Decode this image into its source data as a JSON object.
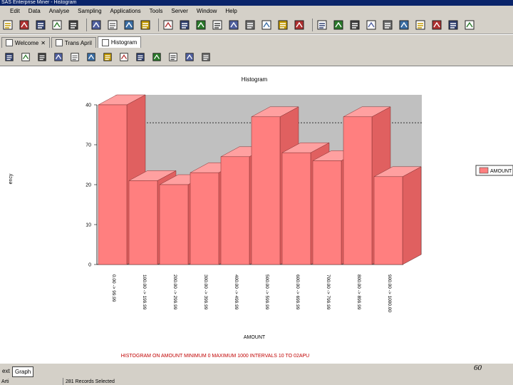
{
  "window": {
    "title": "SAS Enterprise Miner - Histogram"
  },
  "menu": [
    "Edit",
    "Data",
    "Analyse",
    "Sampling",
    "Applications",
    "Tools",
    "Server",
    "Window",
    "Help"
  ],
  "toolbar_icons": [
    "open-folder-icon",
    "open-icon",
    "save-icon",
    "export-icon",
    "print-icon",
    "undo-icon",
    "data-icon",
    "arrow-icon",
    "notes-icon",
    "document-icon",
    "table-icon",
    "edit-table-icon",
    "grid-icon",
    "grid-delete-icon",
    "sas-icon",
    "columns-icon",
    "refresh-icon",
    "percent-icon",
    "split-icon",
    "compare-icon",
    "sort-icon",
    "number-icon",
    "rank-icon",
    "stats-icon",
    "chart-icon",
    "globe-icon",
    "export-data-icon",
    "import-data-icon"
  ],
  "tabs": [
    {
      "label": "Welcome",
      "active": false
    },
    {
      "label": "Trans April",
      "active": false
    },
    {
      "label": "Histogram",
      "active": true
    }
  ],
  "graph_toolbar_icons": [
    "histogram-icon",
    "bar-chart-icon",
    "stacked-bar-icon",
    "line-chart-icon",
    "frame-icon",
    "picture-icon",
    "scatter-icon",
    "box-plot-icon",
    "image-icon",
    "calendar-icon",
    "camera-icon",
    "eye-icon",
    "rotate-icon"
  ],
  "chart_data": {
    "type": "bar",
    "title": "Histogram",
    "xlabel": "AMOUNT",
    "ylabel": "ency",
    "categories": [
      "0.00 -> 99.99",
      "100.00 -> 199.99",
      "200.00 -> 299.99",
      "300.00 -> 399.99",
      "400.00 -> 499.99",
      "500.00 -> 599.99",
      "600.00 -> 699.99",
      "700.00 -> 799.99",
      "800.00 -> 899.99",
      "900.00 -> 1000.00"
    ],
    "values": [
      40,
      21,
      20,
      23,
      27,
      37,
      28,
      26,
      37,
      22
    ],
    "ylim": [
      0,
      40
    ],
    "yticks": [
      0,
      10,
      20,
      30,
      40
    ],
    "ytick_labels": [
      "0",
      "10",
      "20",
      "70",
      "40"
    ],
    "reference_line": 33,
    "bar_color": "#ff7f7f",
    "wall_color": "#c0c0c0",
    "legend": {
      "label": "AMOUNT",
      "position": "right"
    },
    "footnote": "HISTOGRAM ON AMOUNT MINIMUM 0 MAXIMUM 1000 INTERVALS 10 TO 02APU",
    "footnote_color": "#c00000"
  },
  "bottom_tabs": [
    {
      "label": "ext",
      "active": false
    },
    {
      "label": "Graph",
      "active": true
    }
  ],
  "status": {
    "left": "Arti",
    "records": "281 Records Selected"
  },
  "page_number": "60"
}
